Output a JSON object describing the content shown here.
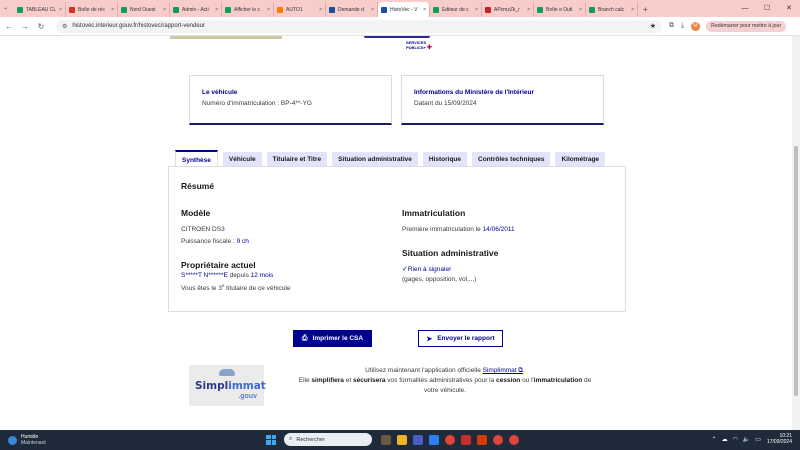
{
  "browser": {
    "tabs": [
      {
        "label": "TABLEAU CL",
        "color": "#0f9d58"
      },
      {
        "label": "Boîte de réc",
        "color": "#d93025"
      },
      {
        "label": "Nord Ouest",
        "color": "#0f9d58"
      },
      {
        "label": "Admin - Acti",
        "color": "#0f9d58"
      },
      {
        "label": "Afficher le c",
        "color": "#0f9d58"
      },
      {
        "label": "AUTO1",
        "color": "#ff7a00"
      },
      {
        "label": "Demande d",
        "color": "#1a4fa0"
      },
      {
        "label": "HistoVec - V",
        "color": "#1a4fa0",
        "active": true
      },
      {
        "label": "Editeur de c",
        "color": "#0f9d58"
      },
      {
        "label": "APzmzZk_r",
        "color": "#c5221f"
      },
      {
        "label": "Boîte e Outl",
        "color": "#0f9d58"
      },
      {
        "label": "Branch calc",
        "color": "#0f9d58"
      }
    ],
    "new_tab": "+",
    "url": "histovec.interieur.gouv.fr/histovec/rapport-vendeur",
    "avatar_letter": "M",
    "restart_label": "Redémarrer pour mettre à jour"
  },
  "header": {
    "logo_line1": "SERVICES",
    "logo_line2": "PUBLICS+"
  },
  "cards": {
    "vehicle": {
      "title": "Le véhicule",
      "text": "Numéro d'immatriculation : BP-4**-YG"
    },
    "ministry": {
      "title": "Informations du Ministère de l'Intérieur",
      "text": "Datant du 15/09/2024"
    }
  },
  "tabs": [
    "Synthèse",
    "Véhicule",
    "Titulaire et Titre",
    "Situation administrative",
    "Historique",
    "Contrôles techniques",
    "Kilométrage"
  ],
  "summary": {
    "title": "Résumé",
    "model": {
      "title": "Modèle",
      "name": "CITROEN DS3",
      "power_label": "Puissance fiscale : ",
      "power_value": "9 ch"
    },
    "owner": {
      "title": "Propriétaire actuel",
      "name": "S*****T N******E",
      "since_label": " depuis ",
      "since_value": "12 mois",
      "rank_prefix": "Vous êtes le 3",
      "rank_sup": "e",
      "rank_suffix": " titulaire de ce véhicule"
    },
    "registration": {
      "title": "Immatriculation",
      "label": "Première immatriculation le ",
      "date": "14/06/2011"
    },
    "admin": {
      "title": "Situation administrative",
      "status": "Rien à signaler",
      "detail": "(gages, opposition, vol,...)"
    }
  },
  "actions": {
    "print": "Imprimer le CSA",
    "send": "Envoyer le rapport"
  },
  "promo": {
    "logo_main": "Simpl",
    "logo_accent": "immat",
    "logo_suffix": ".gouv",
    "line1_before": "Utilisez maintenant l'application officielle ",
    "line1_link": "Simplimmat",
    "line1_after": ".",
    "line2_a": "Elle ",
    "line2_b": "simplifiera",
    "line2_c": " et ",
    "line2_d": "sécurisera",
    "line2_e": " vos formalités administratives pour la ",
    "line2_f": "cession",
    "line2_g": " ou l'",
    "line2_h": "immatriculation",
    "line2_i": " de",
    "line3": "votre véhicule."
  },
  "taskbar": {
    "weather_title": "Humide",
    "weather_sub": "Maintenant",
    "search_placeholder": "Rechercher",
    "time": "10:21",
    "date": "17/09/2024"
  }
}
